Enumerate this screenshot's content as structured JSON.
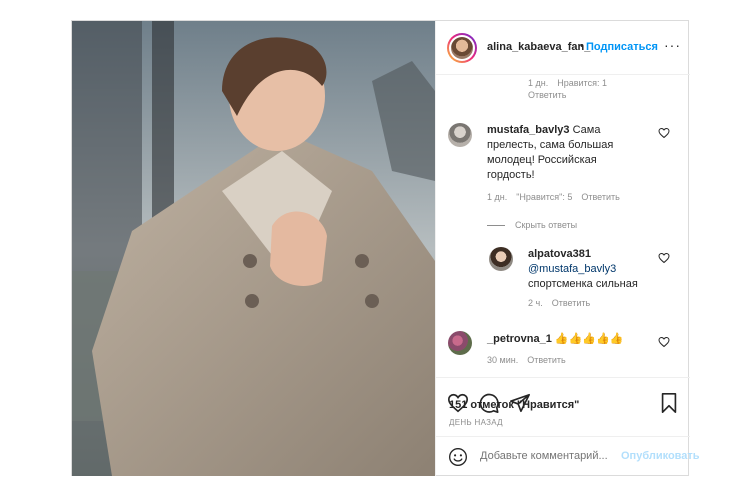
{
  "header": {
    "username": "alina_kabaeva_fan_",
    "separator": "•",
    "follow_label": "Подписаться",
    "more_label": "···"
  },
  "comments": {
    "top_meta": {
      "time": "1 дн.",
      "likes": "Нравится: 1",
      "reply": "Ответить"
    },
    "items": [
      {
        "username": "mustafa_bavly3",
        "text": "Сама прелесть, сама большая молодец! Российская гордость!",
        "time": "1 дн.",
        "likes": "\"Нравится\": 5",
        "reply": "Ответить"
      },
      {
        "username": "alpatova381",
        "mention": "@mustafa_bavly3",
        "text": "спортсменка сильная",
        "time": "2 ч.",
        "reply": "Ответить"
      },
      {
        "username": "_petrovna_1",
        "text": "👍👍👍👍👍",
        "time": "30 мин.",
        "reply": "Ответить"
      }
    ],
    "hide_replies_label": "Скрыть ответы"
  },
  "post": {
    "likes_text": "151 отметок \"Нравится\"",
    "date_text": "ДЕНЬ НАЗАД"
  },
  "add_comment": {
    "placeholder": "Добавьте комментарий...",
    "publish_label": "Опубликовать"
  },
  "icons": {
    "like": "heart-icon",
    "comment": "comment-icon",
    "share": "paper-plane-icon",
    "save": "bookmark-icon",
    "emoji": "smiley-icon",
    "more": "ellipsis-icon"
  },
  "colors": {
    "accent": "#0095f6",
    "publish_disabled": "#b2dffc",
    "muted": "#8e8e8e"
  }
}
